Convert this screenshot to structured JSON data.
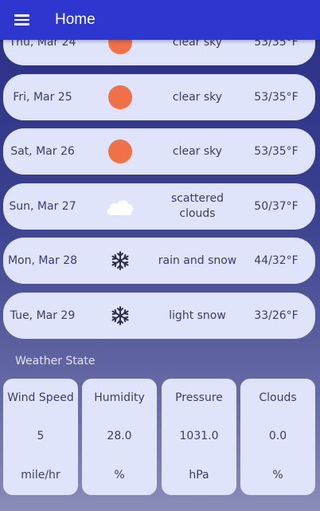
{
  "app": {
    "title": "Home",
    "menu_icon": "hamburger-menu-icon"
  },
  "forecast": [
    {
      "date": "Thu, Mar 24",
      "icon": "sun-icon",
      "condition": "clear sky",
      "temp": "53/35°F"
    },
    {
      "date": "Fri, Mar 25",
      "icon": "sun-icon",
      "condition": "clear sky",
      "temp": "53/35°F"
    },
    {
      "date": "Sat, Mar 26",
      "icon": "sun-icon",
      "condition": "clear sky",
      "temp": "53/35°F"
    },
    {
      "date": "Sun, Mar 27",
      "icon": "cloud-icon",
      "condition": "scattered clouds",
      "temp": "50/37°F"
    },
    {
      "date": "Mon, Mar 28",
      "icon": "snowflake-icon",
      "condition": "rain and snow",
      "temp": "44/32°F"
    },
    {
      "date": "Tue, Mar 29",
      "icon": "snowflake-icon",
      "condition": "light snow",
      "temp": "33/26°F"
    }
  ],
  "weather_state": {
    "title": "Weather State",
    "cards": [
      {
        "label": "Wind Speed",
        "value": "5",
        "unit": "mile/hr"
      },
      {
        "label": "Humidity",
        "value": "28.0",
        "unit": "%"
      },
      {
        "label": "Pressure",
        "value": "1031.0",
        "unit": "hPa"
      },
      {
        "label": "Clouds",
        "value": "0.0",
        "unit": "%"
      }
    ]
  },
  "colors": {
    "appbar": "#2d37d0",
    "card": "#dfe4fb",
    "sun": "#f07048",
    "text": "#3a3e6a"
  }
}
